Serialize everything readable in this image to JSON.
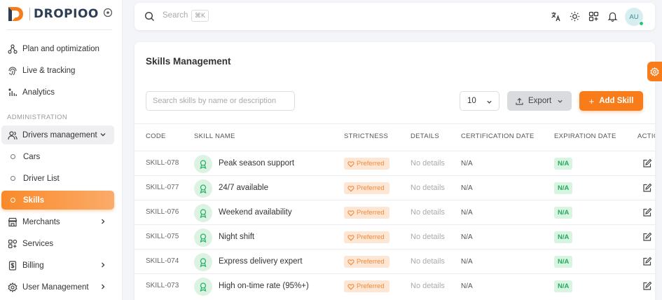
{
  "brand": {
    "name": "DROPIOO",
    "accent": "#f97c1b"
  },
  "sidebar": {
    "items": [
      {
        "label": "Plan and optimization",
        "icon": "route-icon"
      },
      {
        "label": "Live & tracking",
        "icon": "fingerprint-icon"
      },
      {
        "label": "Analytics",
        "icon": "analytics-icon"
      }
    ],
    "section_label": "ADMINISTRATION",
    "drivers_management": {
      "label": "Drivers management",
      "children": [
        {
          "label": "Cars",
          "active": false
        },
        {
          "label": "Driver List",
          "active": false
        },
        {
          "label": "Skills",
          "active": true
        }
      ]
    },
    "more_items": [
      {
        "label": "Merchants",
        "icon": "store-icon",
        "expandable": true
      },
      {
        "label": "Services",
        "icon": "grid-icon",
        "expandable": false
      },
      {
        "label": "Billing",
        "icon": "billing-icon",
        "expandable": true
      },
      {
        "label": "User Management",
        "icon": "gear-icon",
        "expandable": true
      }
    ]
  },
  "topbar": {
    "search_placeholder": "Search",
    "search_shortcut": "⌘K",
    "avatar_initials": "AU"
  },
  "page": {
    "title": "Skills Management",
    "search_placeholder": "Search skills by name or description",
    "page_size": "10",
    "export_label": "Export",
    "add_label": "Add Skill"
  },
  "table": {
    "headers": [
      "CODE",
      "SKILL NAME",
      "STRICTNESS",
      "DETAILS",
      "CERTIFICATION DATE",
      "EXPIRATION DATE",
      "ACTIO"
    ],
    "rows": [
      {
        "code": "SKILL-078",
        "name": "Peak season support",
        "strictness": "Preferred",
        "details": "No details",
        "certification": "N/A",
        "expiration": "N/A"
      },
      {
        "code": "SKILL-077",
        "name": "24/7 available",
        "strictness": "Preferred",
        "details": "No details",
        "certification": "N/A",
        "expiration": "N/A"
      },
      {
        "code": "SKILL-076",
        "name": "Weekend availability",
        "strictness": "Preferred",
        "details": "No details",
        "certification": "N/A",
        "expiration": "N/A"
      },
      {
        "code": "SKILL-075",
        "name": "Night shift",
        "strictness": "Preferred",
        "details": "No details",
        "certification": "N/A",
        "expiration": "N/A"
      },
      {
        "code": "SKILL-074",
        "name": "Express delivery expert",
        "strictness": "Preferred",
        "details": "No details",
        "certification": "N/A",
        "expiration": "N/A"
      },
      {
        "code": "SKILL-073",
        "name": "High on-time rate (95%+)",
        "strictness": "Preferred",
        "details": "No details",
        "certification": "N/A",
        "expiration": "N/A"
      }
    ]
  }
}
